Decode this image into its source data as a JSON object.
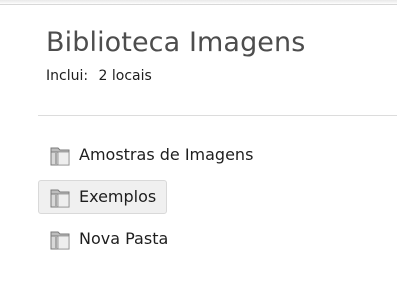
{
  "library": {
    "title": "Biblioteca Imagens",
    "includes_label": "Inclui:",
    "includes_value": "2 locais"
  },
  "folders": [
    {
      "label": "Amostras de Imagens",
      "icon": "folder-icon",
      "selected": false
    },
    {
      "label": "Exemplos",
      "icon": "folder-icon",
      "selected": true
    },
    {
      "label": "Nova Pasta",
      "icon": "folder-icon",
      "selected": false
    }
  ],
  "colors": {
    "title": "#4d4d4d",
    "text": "#1e1e1e",
    "selected_bg": "#f0f0f0",
    "selected_border": "#d9d9d9",
    "divider": "#dcdcdc"
  }
}
